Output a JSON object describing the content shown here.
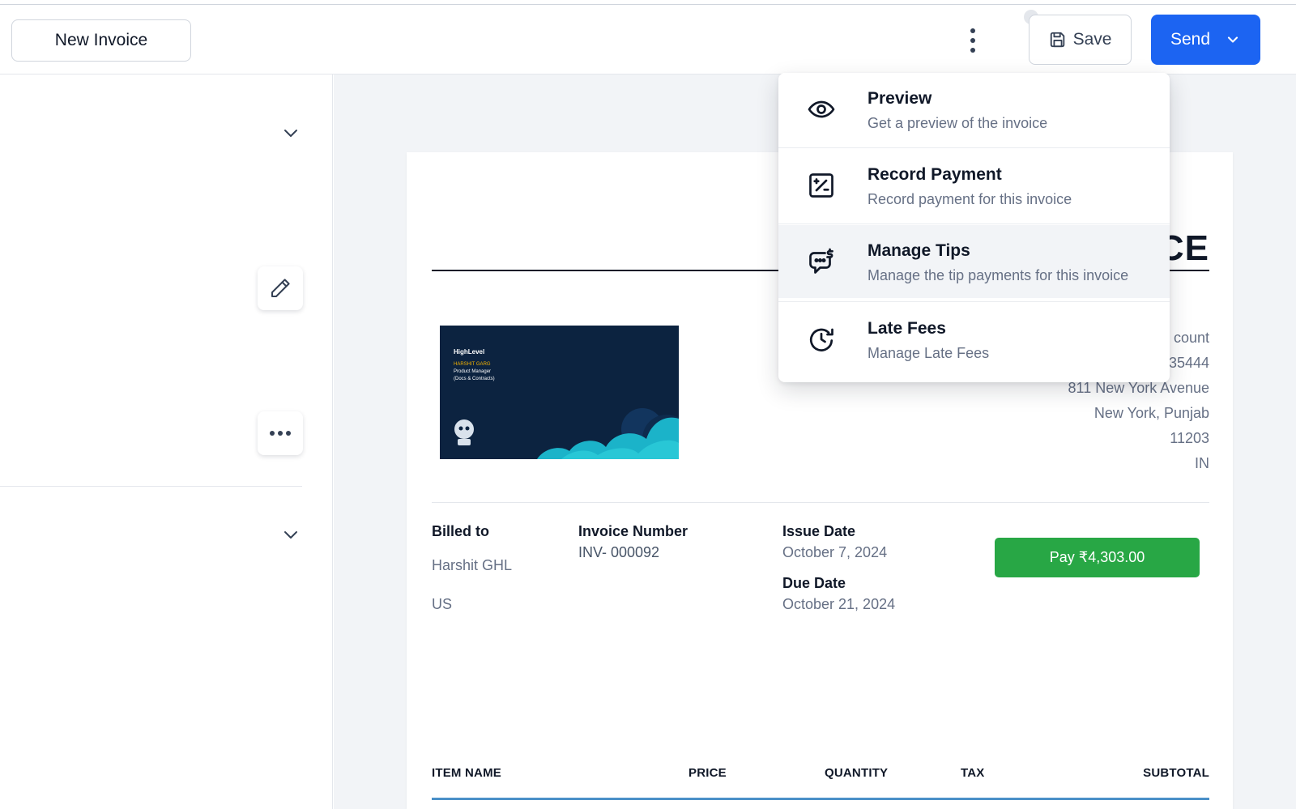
{
  "header": {
    "title": "New Invoice",
    "save_label": "Save",
    "send_label": "Send"
  },
  "invoice": {
    "title_partial": "CE",
    "sender": {
      "account_partial": "count",
      "phone_partial": "35444",
      "street": "811 New York Avenue",
      "city_state": "New York, Punjab",
      "zip": "11203",
      "country": "IN"
    },
    "logo": {
      "brand": "HighLevel",
      "name": "HARSHIT GARG",
      "role": "Product Manager",
      "team": "(Docs & Contracts)"
    },
    "billed_to_label": "Billed to",
    "billed_to_name": "Harshit GHL",
    "billed_to_country": "US",
    "invoice_number_label": "Invoice Number",
    "invoice_number": "INV- 000092",
    "issue_date_label": "Issue Date",
    "issue_date": "October 7, 2024",
    "due_date_label": "Due Date",
    "due_date": "October 21, 2024",
    "pay_button": "Pay ₹4,303.00",
    "table_headers": [
      "ITEM NAME",
      "PRICE",
      "QUANTITY",
      "TAX",
      "SUBTOTAL"
    ]
  },
  "menu": {
    "items": [
      {
        "title": "Preview",
        "description": "Get a preview of the invoice",
        "icon": "eye-icon"
      },
      {
        "title": "Record Payment",
        "description": "Record payment for this invoice",
        "icon": "payment-receipt-icon"
      },
      {
        "title": "Manage Tips",
        "description": "Manage the tip payments for this invoice",
        "icon": "tips-chat-icon"
      },
      {
        "title": "Late Fees",
        "description": "Manage Late Fees",
        "icon": "clock-refresh-icon"
      }
    ]
  },
  "colors": {
    "primary": "#1c64f2",
    "pay_green": "#28a745",
    "table_accent": "#4a90c8"
  }
}
